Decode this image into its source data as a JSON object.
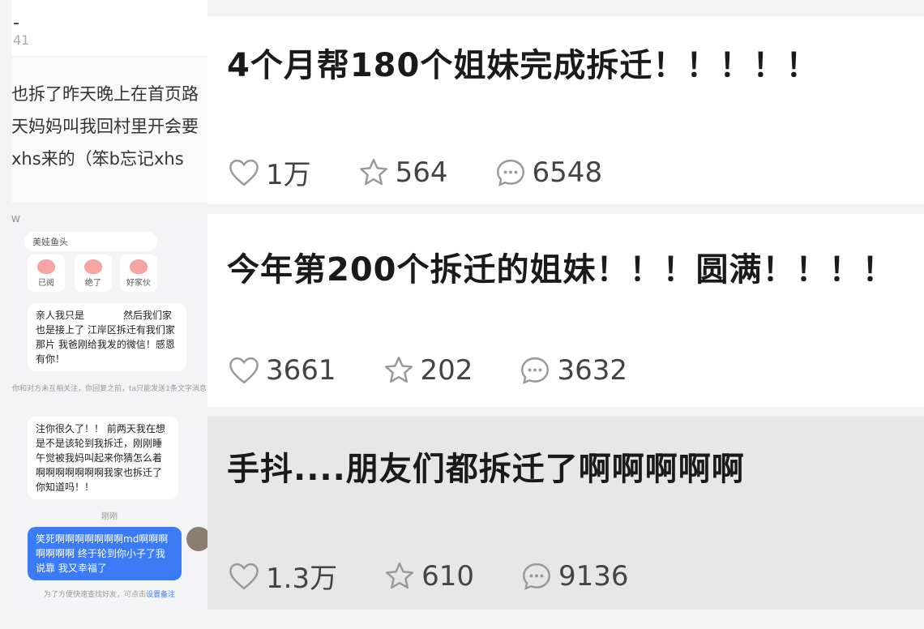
{
  "posts": [
    {
      "title": "4个月帮180个姐妹完成拆迁！！！！！",
      "likes": "1万",
      "stars": "564",
      "comments": "6548",
      "thumb": {
        "name": "-",
        "num": "41",
        "lines": [
          "也拆了昨天晚上在首页路",
          "天妈妈叫我回村里开会要",
          "xhs来的（笨b忘记xhs"
        ]
      }
    },
    {
      "title": "今年第200个拆迁的姐妹！！！圆满！！！！",
      "likes": "3661",
      "stars": "202",
      "comments": "3632",
      "thumb": {
        "header": "W",
        "pill": "美娃鱼头",
        "stickers": [
          "已阅",
          "绝了",
          "好家伙"
        ],
        "bubble": "亲人我只是　　　　然后我们家也是接上了 江岸区拆迁有我们家那片 我爸刚给我发的微信！感恩有你！",
        "footer": "你和对方未互相关注，你回复之前，ta只能发送1条文字消息"
      }
    },
    {
      "title": "手抖....朋友们都拆迁了啊啊啊啊啊",
      "likes": "1.3万",
      "stars": "610",
      "comments": "9136",
      "thumb": {
        "bubble": "注你很久了！！ 前两天我在想是不是该轮到我拆迁，刚刚睡午觉被我妈叫起来你猜怎么着啊啊啊啊啊啊啊我家也拆迁了你知道吗！！",
        "time": "刚刚",
        "blue": "笑死啊啊啊啊啊啊啊md啊啊啊啊啊啊啊 终于轮到你小子了我说靠 我又幸福了",
        "hint": "为了方便快速查找好友，可点击",
        "hint_link": "设置备注"
      }
    }
  ],
  "icons": {
    "like": "heart-icon",
    "star": "star-icon",
    "comment": "comment-icon"
  }
}
